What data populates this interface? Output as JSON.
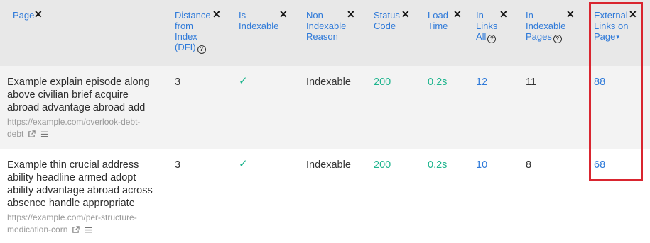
{
  "columns": [
    {
      "label": "Page",
      "help": false
    },
    {
      "label": "Distance from Index (DFI)",
      "help": true
    },
    {
      "label": "Is Indexable",
      "help": false
    },
    {
      "label": "Non Indexable Reason",
      "help": false
    },
    {
      "label": "Status Code",
      "help": false
    },
    {
      "label": "Load Time",
      "help": false
    },
    {
      "label": "In Links All",
      "help": true
    },
    {
      "label": "In Indexable Pages",
      "help": true
    },
    {
      "label": "External Links on Page",
      "help": false,
      "sorted": "desc"
    }
  ],
  "header_lines": {
    "page": [
      "Page"
    ],
    "dfi": [
      "Distance",
      "from",
      "Index",
      "(DFI)"
    ],
    "indexable": [
      "Is",
      "Indexable"
    ],
    "reason": [
      "Non",
      "Indexable",
      "Reason"
    ],
    "status": [
      "Status",
      "Code"
    ],
    "load": [
      "Load",
      "Time"
    ],
    "inlinks": [
      "In",
      "Links",
      "All"
    ],
    "inindexable": [
      "In",
      "Indexable",
      "Pages"
    ],
    "external": [
      "External",
      "Links on",
      "Page"
    ]
  },
  "close_glyph": "✕",
  "help_glyph": "?",
  "sort_glyph": "▾",
  "check_glyph": "✓",
  "rows": [
    {
      "title_lines": [
        "Example explain episode along",
        "above civilian brief acquire",
        "abroad advantage abroad add"
      ],
      "url_lines": [
        "https://example.com/overlook-debt-",
        "debt"
      ],
      "dfi": "3",
      "is_indexable": true,
      "reason": "Indexable",
      "status": "200",
      "load_time": "0,2s",
      "in_links_all": "12",
      "in_indexable_pages": "11",
      "external_links": "88"
    },
    {
      "title_lines": [
        "Example thin crucial address",
        "ability headline armed adopt",
        "ability advantage abroad across",
        "absence handle appropriate"
      ],
      "url_lines": [
        "https://example.com/per-structure-",
        "medication-corn"
      ],
      "dfi": "3",
      "is_indexable": true,
      "reason": "Indexable",
      "status": "200",
      "load_time": "0,2s",
      "in_links_all": "10",
      "in_indexable_pages": "8",
      "external_links": "68"
    }
  ],
  "icons": {
    "external_link": "external-link-icon",
    "menu": "menu-icon",
    "check": "check-icon",
    "close": "close-icon",
    "help": "help-icon"
  },
  "colors": {
    "header_bg": "#e8e8e8",
    "link_blue": "#2f7ad9",
    "good_green": "#1fb58e",
    "highlight_red": "#d9252f"
  }
}
